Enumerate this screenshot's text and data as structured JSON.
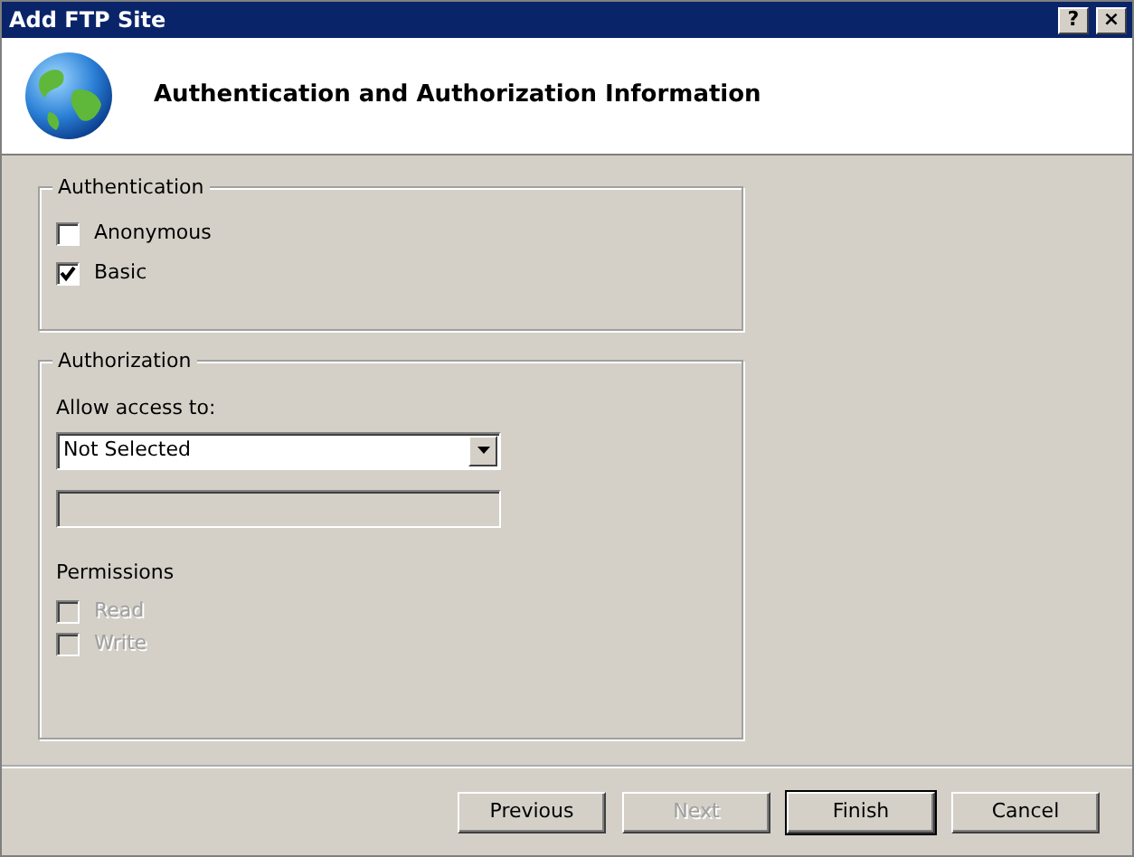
{
  "window": {
    "title": "Add FTP Site"
  },
  "title_buttons": [
    {
      "label": "?"
    },
    {
      "label": "×"
    }
  ],
  "header": {
    "title": "Authentication and Authorization Information"
  },
  "authentication": {
    "legend": "Authentication",
    "options": [
      {
        "label": "Anonymous",
        "checked": false,
        "disabled": false
      },
      {
        "label": "Basic",
        "checked": true,
        "disabled": false
      }
    ]
  },
  "authorization": {
    "legend": "Authorization",
    "allow_label": "Allow access to:",
    "allow_value": "Not Selected",
    "text_field": {
      "disabled": true
    },
    "permissions_label": "Permissions",
    "permissions": [
      {
        "label": "Read",
        "checked": false,
        "disabled": true
      },
      {
        "label": "Write",
        "checked": false,
        "disabled": true
      }
    ]
  },
  "buttons": [
    {
      "label": "Previous",
      "disabled": false,
      "default": false
    },
    {
      "label": "Next",
      "disabled": true,
      "default": false
    },
    {
      "label": "Finish",
      "disabled": false,
      "default": true
    },
    {
      "label": "Cancel",
      "disabled": false,
      "default": false
    }
  ]
}
